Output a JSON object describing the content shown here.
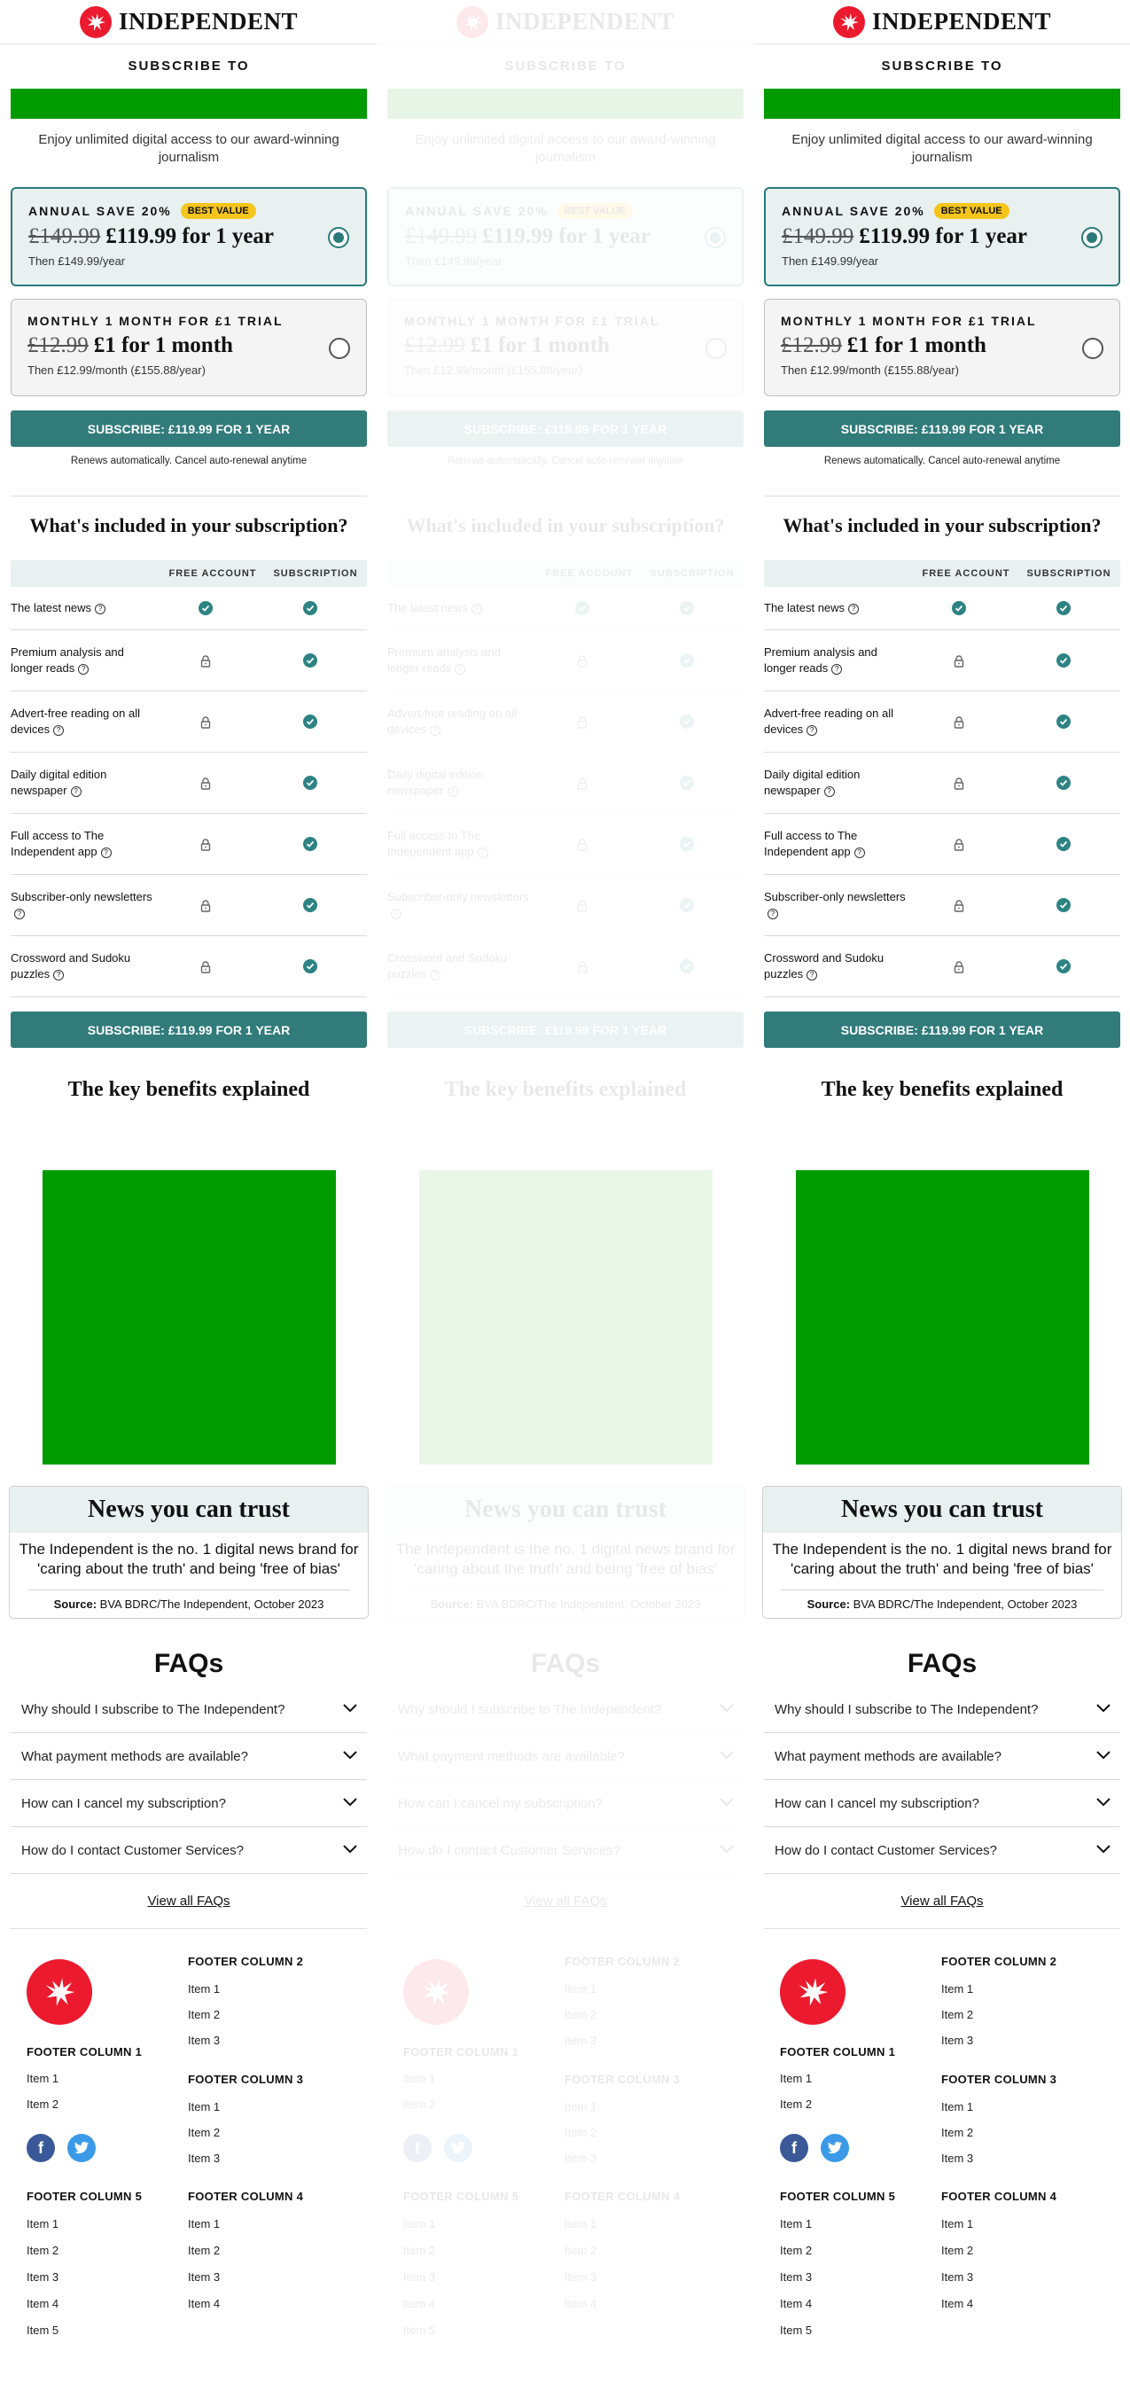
{
  "header": {
    "brand": "INDEPENDENT"
  },
  "subscribe_to": "SUBSCRIBE TO",
  "intro": "Enjoy unlimited digital access to our award-winning journalism",
  "plans": [
    {
      "label": "ANNUAL SAVE 20%",
      "badge": "BEST VALUE",
      "old_price": "£149.99",
      "price": "£119.99 for 1 year",
      "then": "Then £149.99/year",
      "selected": true
    },
    {
      "label": "MONTHLY 1 MONTH FOR £1 TRIAL",
      "badge": "",
      "old_price": "£12.99",
      "price": "£1 for 1 month",
      "then": "Then £12.99/month (£155.88/year)",
      "selected": false
    }
  ],
  "cta": "SUBSCRIBE: £119.99 FOR 1 YEAR",
  "renew_note": "Renews automatically. Cancel auto-renewal anytime",
  "included": {
    "title": "What's included in your subscription?",
    "col_free": "FREE ACCOUNT",
    "col_sub": "SUBSCRIPTION",
    "rows": [
      {
        "feature": "The latest news",
        "free": "check",
        "sub": "check"
      },
      {
        "feature": "Premium analysis and longer reads",
        "free": "lock",
        "sub": "check"
      },
      {
        "feature": "Advert-free reading on all devices",
        "free": "lock",
        "sub": "check"
      },
      {
        "feature": "Daily digital edition newspaper",
        "free": "lock",
        "sub": "check"
      },
      {
        "feature": "Full access to The Independent app",
        "free": "lock",
        "sub": "check"
      },
      {
        "feature": "Subscriber-only newsletters",
        "free": "lock",
        "sub": "check"
      },
      {
        "feature": "Crossword and Sudoku puzzles",
        "free": "lock",
        "sub": "check"
      }
    ]
  },
  "benefits_title": "The key benefits explained",
  "trust": {
    "title": "News you can trust",
    "body": "The Independent is the no. 1 digital news brand for 'caring about the truth' and being 'free of bias'",
    "source_label": "Source:",
    "source": "BVA BDRC/The Independent, October 2023"
  },
  "faqs": {
    "title": "FAQs",
    "items": [
      "Why should I subscribe to The Independent?",
      "What payment methods are available?",
      "How can I cancel my subscription?",
      "How do I contact Customer Services?"
    ],
    "view_all": "View all FAQs"
  },
  "footer": {
    "col1": {
      "title": "FOOTER COLUMN 1",
      "items": [
        "Item 1",
        "Item 2"
      ]
    },
    "col2": {
      "title": "FOOTER COLUMN 2",
      "items": [
        "Item 1",
        "Item 2",
        "Item 3"
      ]
    },
    "col3": {
      "title": "FOOTER COLUMN 3",
      "items": [
        "Item 1",
        "Item 2",
        "Item 3"
      ]
    },
    "col4": {
      "title": "FOOTER COLUMN 4",
      "items": [
        "Item 1",
        "Item 2",
        "Item 3",
        "Item 4"
      ]
    },
    "col5": {
      "title": "FOOTER COLUMN 5",
      "items": [
        "Item 1",
        "Item 2",
        "Item 3",
        "Item 4",
        "Item 5"
      ]
    },
    "social": [
      "facebook-icon",
      "twitter-icon"
    ]
  },
  "colors": {
    "brand_red": "#ec1a2e",
    "teal": "#317b7b",
    "placeholder_green": "#009b00",
    "badge_yellow": "#f5c51c"
  }
}
